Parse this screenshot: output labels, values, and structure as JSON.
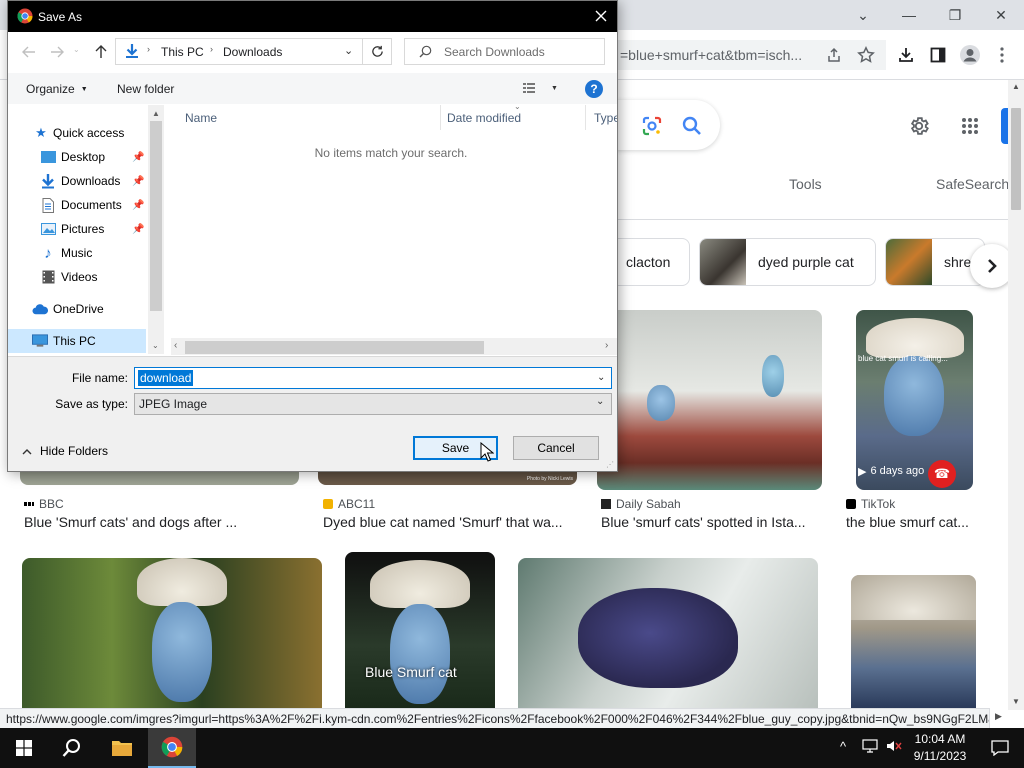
{
  "browser": {
    "omnibox_text": "=blue+smurf+cat&tbm=isch...",
    "window_controls": {
      "minimize": "—",
      "restore": "❐",
      "close": "✕",
      "tab_search": "⌄"
    },
    "toolbar_icons": [
      "share-icon",
      "star-icon",
      "download-icon",
      "sidepanel-icon",
      "profile-icon",
      "menu-icon"
    ]
  },
  "google": {
    "tools_label": "Tools",
    "safesearch_label": "SafeSearch",
    "chips": [
      {
        "label": "clacton"
      },
      {
        "label": "dyed purple cat"
      },
      {
        "label": "shre"
      }
    ],
    "results_row1": [
      {
        "source": "BBC",
        "title": "Blue 'Smurf cats' and dogs after ..."
      },
      {
        "source": "ABC11",
        "title": "Dyed blue cat named 'Smurf' that wa..."
      },
      {
        "source": "Daily Sabah",
        "title": "Blue 'smurf cats' spotted in Ista..."
      },
      {
        "source": "TikTok",
        "title": "the blue smurf cat..."
      }
    ],
    "tiktok_badge": "6 days ago",
    "tiktok_overlay": "blue cat smurf is calling...",
    "row2_overlay_text": "Blue Smurf cat",
    "abc_credit": "Photo by Nicki Lewis"
  },
  "status_url": "https://www.google.com/imgres?imgurl=https%3A%2F%2Fi.kym-cdn.com%2Fentries%2Ficons%2Ffacebook%2F000%2F046%2F344%2Fblue_guy_copy.jpg&tbnid=nQw_bs9NGgF2LM&...",
  "dialog": {
    "title": "Save As",
    "breadcrumb": [
      "This PC",
      "Downloads"
    ],
    "search_placeholder": "Search Downloads",
    "organize_label": "Organize",
    "new_folder_label": "New folder",
    "help_glyph": "?",
    "nav_items": [
      {
        "label": "Quick access",
        "icon": "star-icon"
      },
      {
        "label": "Desktop",
        "icon": "desktop-icon"
      },
      {
        "label": "Downloads",
        "icon": "download-arrow-icon"
      },
      {
        "label": "Documents",
        "icon": "document-icon"
      },
      {
        "label": "Pictures",
        "icon": "picture-icon"
      },
      {
        "label": "Music",
        "icon": "music-note-icon"
      },
      {
        "label": "Videos",
        "icon": "film-icon"
      },
      {
        "label": "OneDrive",
        "icon": "cloud-icon"
      },
      {
        "label": "This PC",
        "icon": "monitor-icon"
      }
    ],
    "columns": [
      "Name",
      "Date modified",
      "Type"
    ],
    "empty_message": "No items match your search.",
    "file_name_label": "File name:",
    "file_name_value": "download",
    "save_type_label": "Save as type:",
    "save_type_value": "JPEG Image",
    "hide_folders_label": "Hide Folders",
    "save_label": "Save",
    "cancel_label": "Cancel"
  },
  "taskbar": {
    "time": "10:04 AM",
    "date": "9/11/2023"
  },
  "colors": {
    "accent": "#0078d7",
    "google_blue": "#4285f4",
    "taskbar": "#101010"
  }
}
